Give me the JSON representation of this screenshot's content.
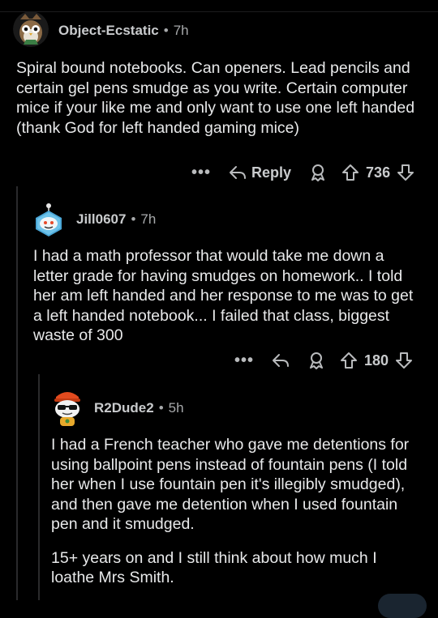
{
  "comments": [
    {
      "author": "Object-Ecstatic",
      "time": "7h",
      "body": [
        "Spiral bound notebooks. Can openers. Lead pencils and certain gel pens smudge as you write. Certain computer mice if your like me and only want to use one left handed (thank God for left handed gaming mice)"
      ],
      "reply_label": "Reply",
      "votes": "736"
    },
    {
      "author": "Jill0607",
      "time": "7h",
      "body": [
        "I had a math professor that would take me down a letter grade for having smudges on homework.. I told her am left handed and her response to me was to get a left handed notebook... I failed that class, biggest waste of 300"
      ],
      "votes": "180"
    },
    {
      "author": "R2Dude2",
      "time": "5h",
      "body": [
        "I had a French teacher who gave me detentions for using ballpoint pens instead of fountain pens (I told her when I use fountain pen it's illegibly smudged), and then gave me detention when I used fountain pen and it smudged.",
        "15+ years on and I still think about how much I loathe Mrs Smith."
      ]
    }
  ],
  "colors": {
    "background": "#000000",
    "text": "#e8e9ea",
    "meta": "#a7a9ab",
    "thread_line": "#2a2a2c"
  },
  "icons": [
    "more-icon",
    "reply-icon",
    "award-icon",
    "upvote-icon",
    "downvote-icon"
  ]
}
